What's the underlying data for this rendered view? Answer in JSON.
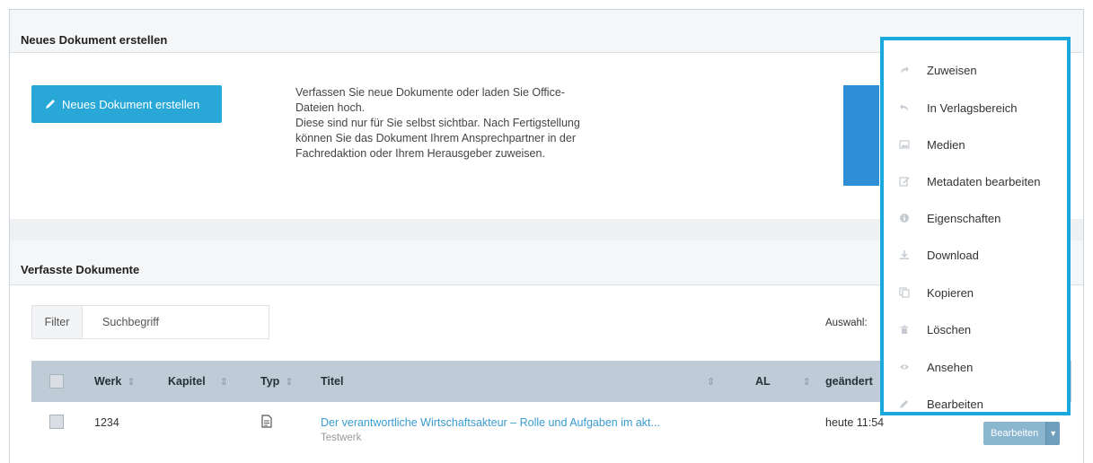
{
  "panel_new": {
    "title": "Neues Dokument erstellen",
    "button_label": "Neues Dokument erstellen",
    "description": [
      "Verfassen Sie neue Dokumente oder laden Sie Office-",
      "Dateien hoch.",
      "Diese sind nur für Sie selbst sichtbar. Nach Fertigstellung",
      "können Sie das Dokument Ihrem Ansprechpartner in der",
      "Fachredaktion oder Ihrem Herausgeber zuweisen."
    ]
  },
  "panel_docs": {
    "title": "Verfasste Dokumente",
    "filter_label": "Filter",
    "search_placeholder": "Suchbegriff",
    "selection_label": "Auswahl:"
  },
  "table": {
    "columns": {
      "werk": "Werk",
      "kapitel": "Kapitel",
      "typ": "Typ",
      "titel": "Titel",
      "al": "AL",
      "geaendert": "geändert"
    },
    "row": {
      "werk": "1234",
      "title": "Der verantwortliche Wirtschaftsakteur – Rolle und Aufgaben im akt...",
      "subtitle": "Testwerk",
      "changed": "heute 11:54",
      "edit_label": "Bearbeiten"
    }
  },
  "context_menu": {
    "items": [
      {
        "label": "Zuweisen",
        "icon": "share-arrow-icon"
      },
      {
        "label": "In Verlagsbereich",
        "icon": "reply-arrow-icon"
      },
      {
        "label": "Medien",
        "icon": "image-icon"
      },
      {
        "label": "Metadaten bearbeiten",
        "icon": "edit-metadata-icon"
      },
      {
        "label": "Eigenschaften",
        "icon": "info-icon"
      },
      {
        "label": "Download",
        "icon": "download-icon"
      },
      {
        "label": "Kopieren",
        "icon": "copy-icon"
      },
      {
        "label": "Löschen",
        "icon": "trash-icon"
      },
      {
        "label": "Ansehen",
        "icon": "eye-icon"
      },
      {
        "label": "Bearbeiten",
        "icon": "pencil-icon"
      }
    ]
  },
  "colors": {
    "accent": "#1ba8dc",
    "primary_button": "#29a8d8",
    "link": "#3a9bd0",
    "table_header": "#bfcbd6"
  }
}
